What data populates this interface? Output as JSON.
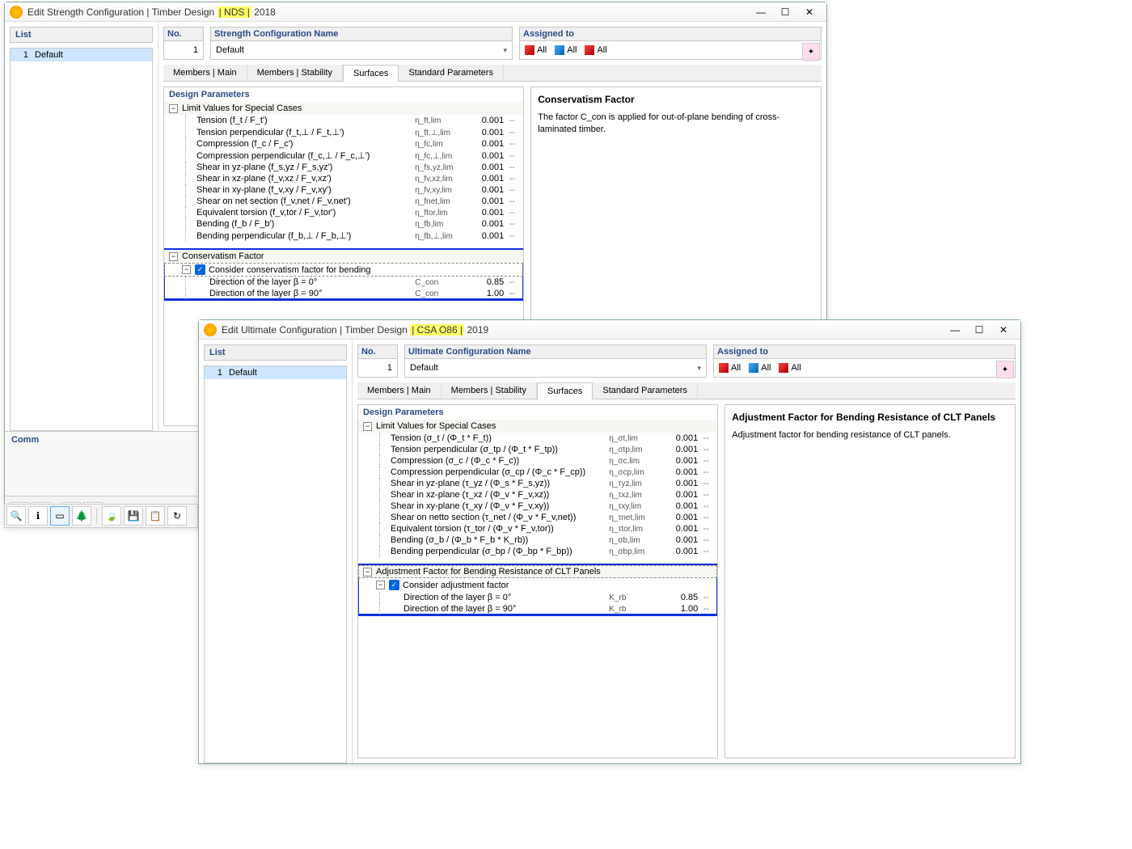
{
  "w1": {
    "title_pre": "Edit Strength Configuration | Timber Design ",
    "title_hl": "| NDS |",
    "title_post": " 2018",
    "list_hdr": "List",
    "list_item_no": "1",
    "list_item_name": "Default",
    "no_lbl": "No.",
    "no_val": "1",
    "name_lbl": "Strength Configuration Name",
    "name_val": "Default",
    "assigned_lbl": "Assigned to",
    "assigned_all": "All",
    "tabs": [
      "Members | Main",
      "Members | Stability",
      "Surfaces",
      "Standard Parameters"
    ],
    "active_tab": 2,
    "params_hdr": "Design Parameters",
    "group1": "Limit Values for Special Cases",
    "rows1": [
      {
        "lbl": "Tension (f_t / F_t')",
        "sym": "η_ft,lim",
        "val": "0.001",
        "unit": "--"
      },
      {
        "lbl": "Tension perpendicular (f_t,⊥ / F_t,⊥')",
        "sym": "η_ft,⊥,lim",
        "val": "0.001",
        "unit": "--"
      },
      {
        "lbl": "Compression (f_c / F_c')",
        "sym": "η_fc,lim",
        "val": "0.001",
        "unit": "--"
      },
      {
        "lbl": "Compression perpendicular (f_c,⊥ / F_c,⊥')",
        "sym": "η_fc,⊥,lim",
        "val": "0.001",
        "unit": "--"
      },
      {
        "lbl": "Shear in yz-plane (f_s,yz / F_s,yz')",
        "sym": "η_fs,yz,lim",
        "val": "0.001",
        "unit": "--"
      },
      {
        "lbl": "Shear in xz-plane (f_v,xz / F_v,xz')",
        "sym": "η_fv,xz,lim",
        "val": "0.001",
        "unit": "--"
      },
      {
        "lbl": "Shear in xy-plane (f_v,xy / F_v,xy')",
        "sym": "η_fv,xy,lim",
        "val": "0.001",
        "unit": "--"
      },
      {
        "lbl": "Shear on net section (f_v,net / F_v,net')",
        "sym": "η_fnet,lim",
        "val": "0.001",
        "unit": "--"
      },
      {
        "lbl": "Equivalent torsion (f_v,tor / F_v,tor')",
        "sym": "η_ftor,lim",
        "val": "0.001",
        "unit": "--"
      },
      {
        "lbl": "Bending (f_b / F_b')",
        "sym": "η_fb,lim",
        "val": "0.001",
        "unit": "--"
      },
      {
        "lbl": "Bending perpendicular (f_b,⊥ / F_b,⊥')",
        "sym": "η_fb,⊥,lim",
        "val": "0.001",
        "unit": "--"
      }
    ],
    "group2": "Conservatism Factor",
    "chk_lbl": "Consider conservatism factor for bending",
    "rows2": [
      {
        "lbl": "Direction of the layer β = 0°",
        "sym": "C_con",
        "val": "0.85",
        "unit": "--"
      },
      {
        "lbl": "Direction of the layer β = 90°",
        "sym": "C_con",
        "val": "1.00",
        "unit": "--"
      }
    ],
    "desc_title": "Conservatism Factor",
    "desc_text": "The factor C_con is applied for out-of-plane bending of cross-laminated timber.",
    "comm": "Comm"
  },
  "w2": {
    "title_pre": "Edit Ultimate Configuration | Timber Design ",
    "title_hl": "| CSA O86 |",
    "title_post": " 2019",
    "list_hdr": "List",
    "list_item_no": "1",
    "list_item_name": "Default",
    "no_lbl": "No.",
    "no_val": "1",
    "name_lbl": "Ultimate Configuration Name",
    "name_val": "Default",
    "assigned_lbl": "Assigned to",
    "assigned_all": "All",
    "tabs": [
      "Members | Main",
      "Members | Stability",
      "Surfaces",
      "Standard Parameters"
    ],
    "active_tab": 2,
    "params_hdr": "Design Parameters",
    "group1": "Limit Values for Special Cases",
    "rows1": [
      {
        "lbl": "Tension (σ_t / (Φ_t * F_t))",
        "sym": "η_σt,lim",
        "val": "0.001",
        "unit": "--"
      },
      {
        "lbl": "Tension perpendicular (σ_tp / (Φ_t * F_tp))",
        "sym": "η_σtp,lim",
        "val": "0.001",
        "unit": "--"
      },
      {
        "lbl": "Compression (σ_c / (Φ_c * F_c))",
        "sym": "η_σc,lim",
        "val": "0.001",
        "unit": "--"
      },
      {
        "lbl": "Compression perpendicular (σ_cp / (Φ_c * F_cp))",
        "sym": "η_σcp,lim",
        "val": "0.001",
        "unit": "--"
      },
      {
        "lbl": "Shear in yz-plane (τ_yz / (Φ_s * F_s,yz))",
        "sym": "η_τyz,lim",
        "val": "0.001",
        "unit": "--"
      },
      {
        "lbl": "Shear in xz-plane (τ_xz / (Φ_v * F_v,xz))",
        "sym": "η_τxz,lim",
        "val": "0.001",
        "unit": "--"
      },
      {
        "lbl": "Shear in xy-plane (τ_xy / (Φ_v * F_v,xy))",
        "sym": "η_τxy,lim",
        "val": "0.001",
        "unit": "--"
      },
      {
        "lbl": "Shear on netto section (τ_net / (Φ_v * F_v,net))",
        "sym": "η_τnet,lim",
        "val": "0.001",
        "unit": "--"
      },
      {
        "lbl": "Equivalent torsion (τ_tor / (Φ_v * F_v,tor))",
        "sym": "η_τtor,lim",
        "val": "0.001",
        "unit": "--"
      },
      {
        "lbl": "Bending (σ_b / (Φ_b * F_b * K_rb))",
        "sym": "η_σb,lim",
        "val": "0.001",
        "unit": "--"
      },
      {
        "lbl": "Bending perpendicular (σ_bp / (Φ_bp * F_bp))",
        "sym": "η_σbp,lim",
        "val": "0.001",
        "unit": "--"
      }
    ],
    "group2": "Adjustment Factor for Bending Resistance of CLT Panels",
    "chk_lbl": "Consider adjustment factor",
    "rows2": [
      {
        "lbl": "Direction of the layer β = 0°",
        "sym": "K_rb",
        "val": "0.85",
        "unit": "--"
      },
      {
        "lbl": "Direction of the layer β = 90°",
        "sym": "K_rb",
        "val": "1.00",
        "unit": "--"
      }
    ],
    "desc_title": "Adjustment Factor for Bending Resistance of CLT Panels",
    "desc_text": "Adjustment factor for bending resistance of CLT panels."
  }
}
